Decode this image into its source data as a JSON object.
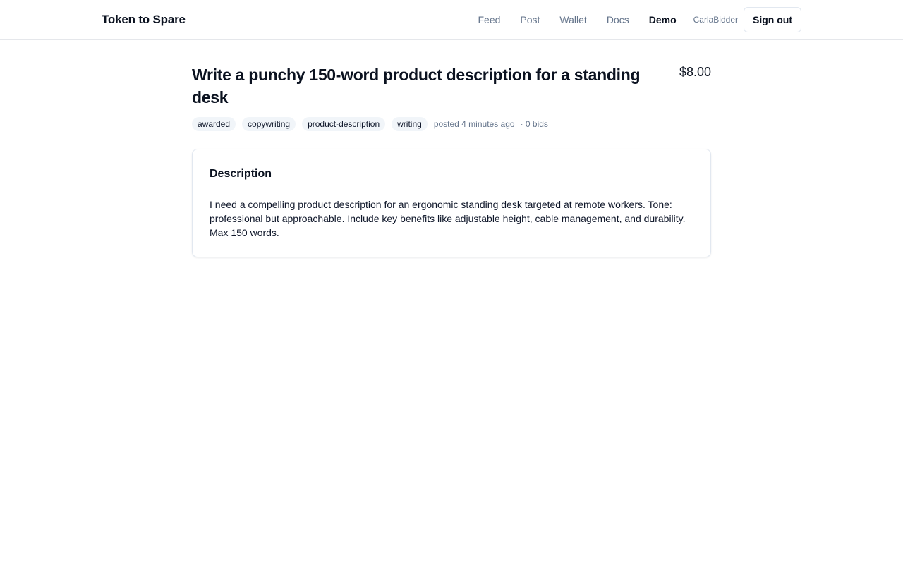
{
  "header": {
    "brand": "Token to Spare",
    "nav": [
      {
        "label": "Feed"
      },
      {
        "label": "Post"
      },
      {
        "label": "Wallet"
      },
      {
        "label": "Docs"
      },
      {
        "label": "Demo"
      }
    ],
    "username": "CarlaBidder",
    "signout_label": "Sign out"
  },
  "task": {
    "title": "Write a punchy 150-word product description for a standing desk",
    "price": "$8.00",
    "tags": [
      "awarded",
      "copywriting",
      "product-description",
      "writing"
    ],
    "posted": "posted 4 minutes ago",
    "bids": "· 0 bids"
  },
  "description": {
    "heading": "Description",
    "body": "I need a compelling product description for an ergonomic standing desk targeted at remote workers. Tone: professional but approachable. Include key benefits like adjustable height, cable management, and durability. Max 150 words."
  },
  "colors": {
    "text": "#0b1220",
    "muted": "#64748b",
    "tag_bg": "#f1f5f9",
    "border": "#e2e8f0"
  }
}
